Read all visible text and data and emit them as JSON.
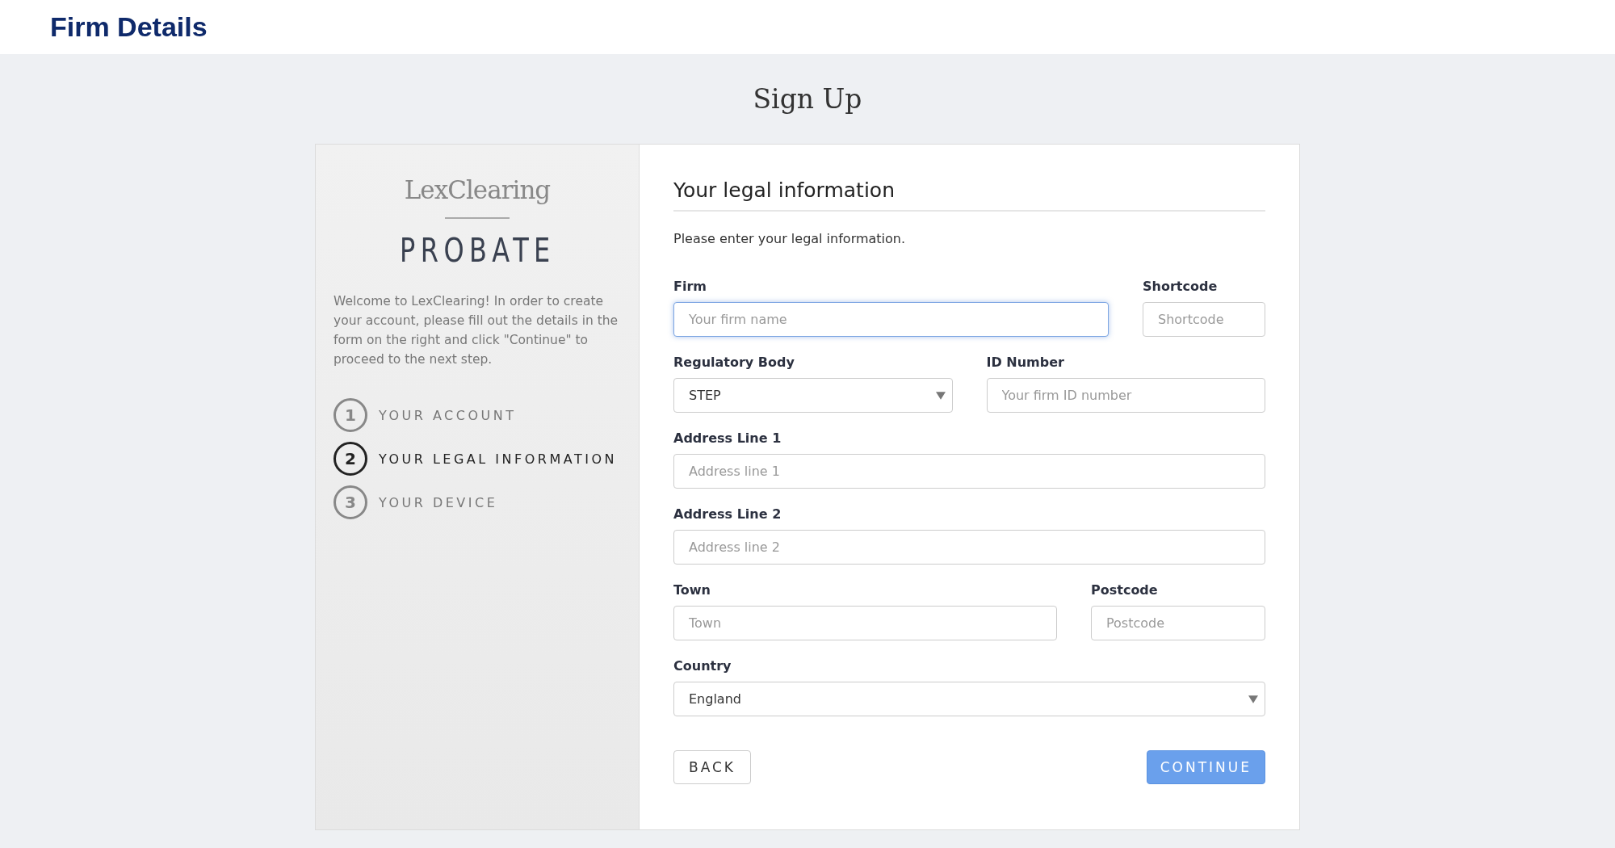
{
  "header": {
    "title": "Firm Details"
  },
  "page_title": "Sign Up",
  "sidebar": {
    "brand": "LexClearing",
    "product": "PROBATE",
    "intro": "Welcome to LexClearing! In order to create your account, please fill out the details in the form on the right and click \"Continue\" to proceed to the next step.",
    "steps": [
      {
        "number": "1",
        "label": "YOUR ACCOUNT",
        "selected": false
      },
      {
        "number": "2",
        "label": "YOUR LEGAL INFORMATION",
        "selected": true
      },
      {
        "number": "3",
        "label": "YOUR DEVICE",
        "selected": false
      }
    ]
  },
  "form": {
    "heading": "Your legal information",
    "description": "Please enter your legal information.",
    "rows": [
      [
        {
          "kind": "input",
          "label": "Firm",
          "placeholder": "Your firm name",
          "focused": true
        },
        {
          "kind": "input",
          "label": "Shortcode",
          "placeholder": "Shortcode",
          "focused": false
        }
      ],
      [
        {
          "kind": "select",
          "label": "Regulatory Body",
          "value": "STEP",
          "focused": false
        },
        {
          "kind": "input",
          "label": "ID Number",
          "placeholder": "Your firm ID number",
          "focused": false
        }
      ],
      [
        {
          "kind": "input",
          "label": "Address Line 1",
          "placeholder": "Address line 1",
          "focused": false
        }
      ],
      [
        {
          "kind": "input",
          "label": "Address Line 2",
          "placeholder": "Address line 2",
          "focused": false
        }
      ],
      [
        {
          "kind": "input",
          "label": "Town",
          "placeholder": "Town",
          "focused": false
        },
        {
          "kind": "input",
          "label": "Postcode",
          "placeholder": "Postcode",
          "focused": false
        }
      ],
      [
        {
          "kind": "select",
          "label": "Country",
          "value": "England",
          "focused": false
        }
      ]
    ],
    "buttons": [
      {
        "label": "BACK",
        "kind": "secondary"
      },
      {
        "label": "CONTINUE",
        "kind": "primary"
      }
    ]
  }
}
